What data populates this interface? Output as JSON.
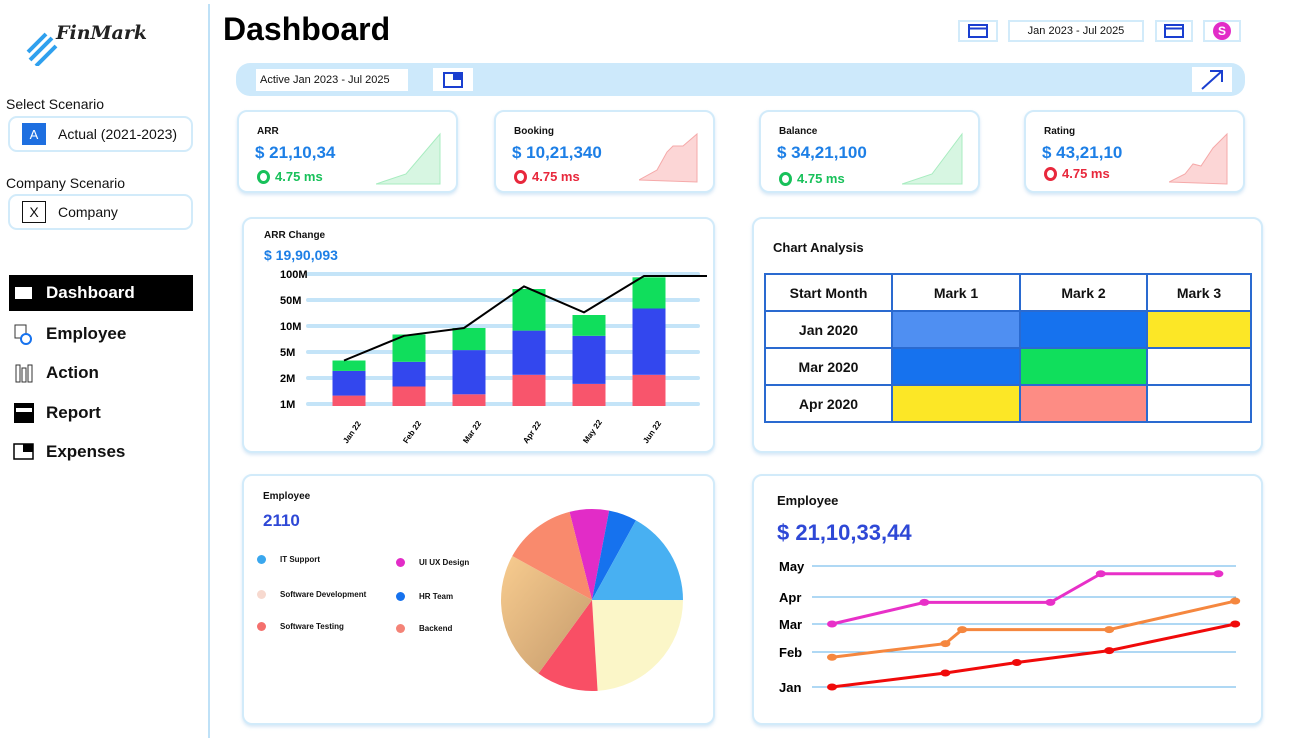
{
  "app": {
    "name": "FinMark"
  },
  "sidebar": {
    "select_scenario_label": "Select Scenario",
    "scenario_badge": "A",
    "scenario_value": "Actual (2021-2023)",
    "company_scenario_label": "Company Scenario",
    "company_badge": "X",
    "company_value": "Company",
    "nav": [
      {
        "label": "Dashboard",
        "icon": "dashboard-icon",
        "active": true
      },
      {
        "label": "Employee",
        "icon": "employee-icon",
        "active": false
      },
      {
        "label": "Action",
        "icon": "action-icon",
        "active": false
      },
      {
        "label": "Report",
        "icon": "report-icon",
        "active": false
      },
      {
        "label": "Expenses",
        "icon": "expenses-icon",
        "active": false
      }
    ]
  },
  "header": {
    "title": "Dashboard",
    "date_range": "Jan 2023 - Jul 2025",
    "avatar_letter": "S",
    "active_label": "Active Jan 2023 - Jul 2025"
  },
  "kpis": [
    {
      "title": "ARR",
      "value": "$ 21,10,34",
      "delta": "4.75 ms",
      "trend": "up",
      "color": "#18c15a"
    },
    {
      "title": "Booking",
      "value": "$ 10,21,340",
      "delta": "4.75 ms",
      "trend": "down",
      "color": "#e8283c"
    },
    {
      "title": "Balance",
      "value": "$ 34,21,100",
      "delta": "4.75 ms",
      "trend": "up",
      "color": "#18c15a"
    },
    {
      "title": "Rating",
      "value": "$ 43,21,10",
      "delta": "4.75 ms",
      "trend": "down",
      "color": "#e8283c"
    }
  ],
  "arr_panel": {
    "title": "ARR Change",
    "value": "$ 19,90,093"
  },
  "chart_analysis": {
    "title": "Chart Analysis",
    "headers": [
      "Start Month",
      "Mark 1",
      "Mark 2",
      "Mark 3"
    ],
    "rows": [
      {
        "label": "Jan 2020",
        "colors": [
          "#4f8ff2",
          "#1672ee",
          "#fce726"
        ]
      },
      {
        "label": "Mar 2020",
        "colors": [
          "#1672ee",
          "#10df5c",
          "#ffffff"
        ]
      },
      {
        "label": "Apr 2020",
        "colors": [
          "#fce726",
          "#fd8c84",
          "#ffffff"
        ]
      }
    ]
  },
  "employee_pie_panel": {
    "title": "Employee",
    "value": "2110",
    "legend": [
      {
        "label": "IT Support",
        "color": "#3aa7ee"
      },
      {
        "label": "UI UX Design",
        "color": "#e22cc7"
      },
      {
        "label": "Software Development",
        "color": "#f7d9cf"
      },
      {
        "label": "HR Team",
        "color": "#1672ee"
      },
      {
        "label": "Software Testing",
        "color": "#f4706d"
      },
      {
        "label": "Backend",
        "color": "#f48377"
      }
    ]
  },
  "employee_line_panel": {
    "title": "Employee",
    "value": "$ 21,10,33,44"
  },
  "chart_data": [
    {
      "type": "bar",
      "stacked": true,
      "title": "ARR Change",
      "categories": [
        "Jan 22",
        "Feb 22",
        "Mar 22",
        "Apr 22",
        "May 22",
        "Jun 22"
      ],
      "y_tick_labels": [
        "1M",
        "2M",
        "5M",
        "10M",
        "50M",
        "100M"
      ],
      "series": [
        {
          "color": "#f8556c",
          "values": [
            0.4,
            0.75,
            0.45,
            1.2,
            0.85,
            1.2
          ]
        },
        {
          "color": "#3347ee",
          "values": [
            0.95,
            0.95,
            1.7,
            1.7,
            1.85,
            2.55
          ]
        },
        {
          "color": "#10de5c",
          "values": [
            0.4,
            1.05,
            0.85,
            1.6,
            0.8,
            1.2
          ]
        }
      ],
      "line": {
        "color": "#000000",
        "values": [
          1.75,
          2.7,
          3.0,
          4.6,
          3.6,
          5.0,
          5.0
        ]
      }
    },
    {
      "type": "pie",
      "slices": [
        {
          "color": "#e22cc7",
          "value": 7
        },
        {
          "color": "#1672ee",
          "value": 5
        },
        {
          "color": "#48b0f2",
          "value": 17
        },
        {
          "color": "#fbf6c8",
          "value": 24
        },
        {
          "color": "#f94f65",
          "value": 11
        },
        {
          "color": "#e2b07e",
          "value": 23
        },
        {
          "color": "#f98a6d",
          "value": 13
        }
      ]
    },
    {
      "type": "line",
      "y_categories": [
        "Jan",
        "Feb",
        "Mar",
        "Apr",
        "May"
      ],
      "series": [
        {
          "color": "#e830c8",
          "points": [
            [
              0,
              2.0
            ],
            [
              1.1,
              2.8
            ],
            [
              2.6,
              2.8
            ],
            [
              3.2,
              3.75
            ],
            [
              4.6,
              3.75
            ]
          ]
        },
        {
          "color": "#f5873f",
          "points": [
            [
              0,
              0.85
            ],
            [
              1.35,
              1.3
            ],
            [
              1.55,
              1.8
            ],
            [
              3.3,
              1.8
            ],
            [
              4.8,
              2.85
            ]
          ]
        },
        {
          "color": "#f00a0a",
          "points": [
            [
              0,
              0.0
            ],
            [
              1.35,
              0.4
            ],
            [
              2.2,
              0.7
            ],
            [
              3.3,
              1.05
            ],
            [
              4.8,
              2.0
            ]
          ]
        }
      ]
    }
  ]
}
